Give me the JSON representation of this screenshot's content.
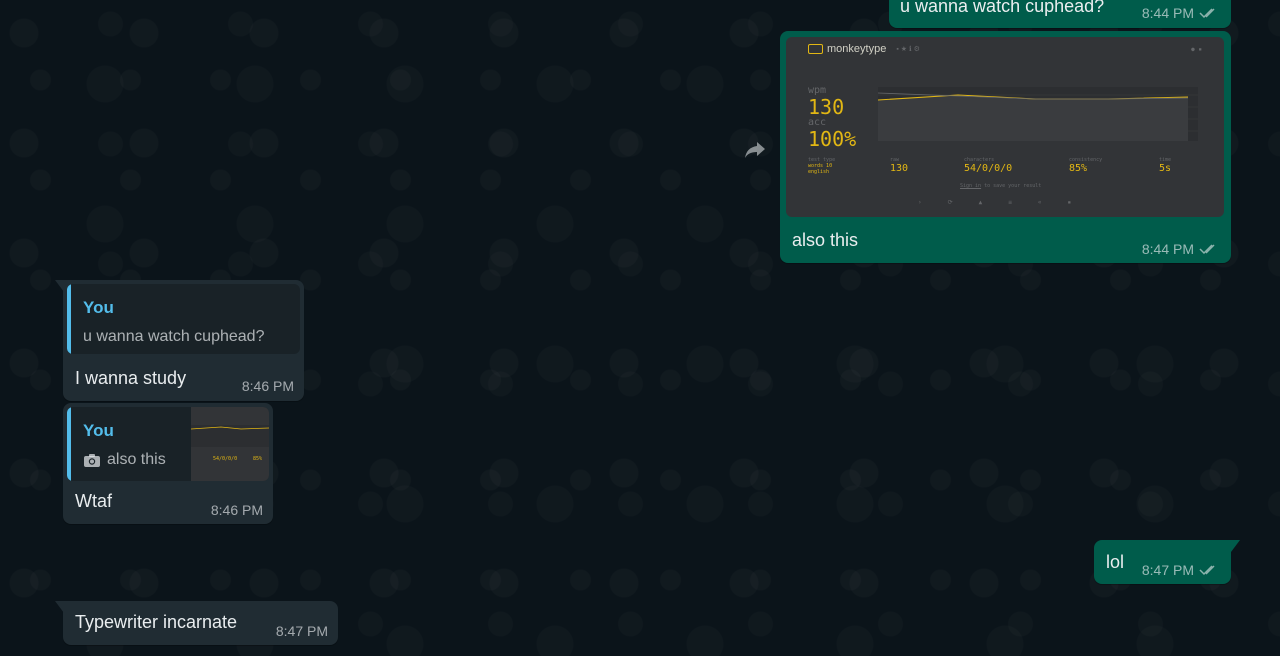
{
  "colors": {
    "outgoing_bubble": "#005c4b",
    "incoming_bubble": "#202c33",
    "quote_accent": "#53bdeb",
    "chat_background": "#0b141a"
  },
  "messages": [
    {
      "direction": "outgoing",
      "text": "u wanna watch cuphead?",
      "time": "8:44 PM",
      "status": "read-double-check-icon"
    },
    {
      "direction": "outgoing",
      "type": "image",
      "caption": "also this",
      "time": "8:44 PM",
      "status": "read-double-check-icon",
      "image": {
        "app_name": "monkeytype",
        "wpm_label": "wpm",
        "wpm_value": "130",
        "acc_label": "acc",
        "acc_value": "100%",
        "test_type_label": "test type",
        "test_type_value_1": "words 10",
        "test_type_value_2": "english",
        "raw_label": "raw",
        "raw_value": "130",
        "characters_label": "characters",
        "characters_value": "54/0/0/0",
        "consistency_label": "consistency",
        "consistency_value": "85%",
        "time_label": "time",
        "time_value": "5s",
        "sign_in_link": "Sign in",
        "sign_in_text": "to save your result"
      }
    },
    {
      "direction": "incoming",
      "quote_author": "You",
      "quote_text": "u wanna watch cuphead?",
      "text": "I wanna study",
      "time": "8:46 PM"
    },
    {
      "direction": "incoming",
      "quote_author": "You",
      "quote_icon": "camera-icon",
      "quote_text": "also this",
      "quote_thumb_value": "54/0/0/0",
      "quote_thumb_pct": "85%",
      "text": "Wtaf",
      "time": "8:46 PM"
    },
    {
      "direction": "outgoing",
      "text": "lol",
      "time": "8:47 PM",
      "status": "read-double-check-icon"
    },
    {
      "direction": "incoming",
      "text": "Typewriter incarnate",
      "time": "8:47 PM"
    }
  ],
  "forward_icon": "forward-icon"
}
